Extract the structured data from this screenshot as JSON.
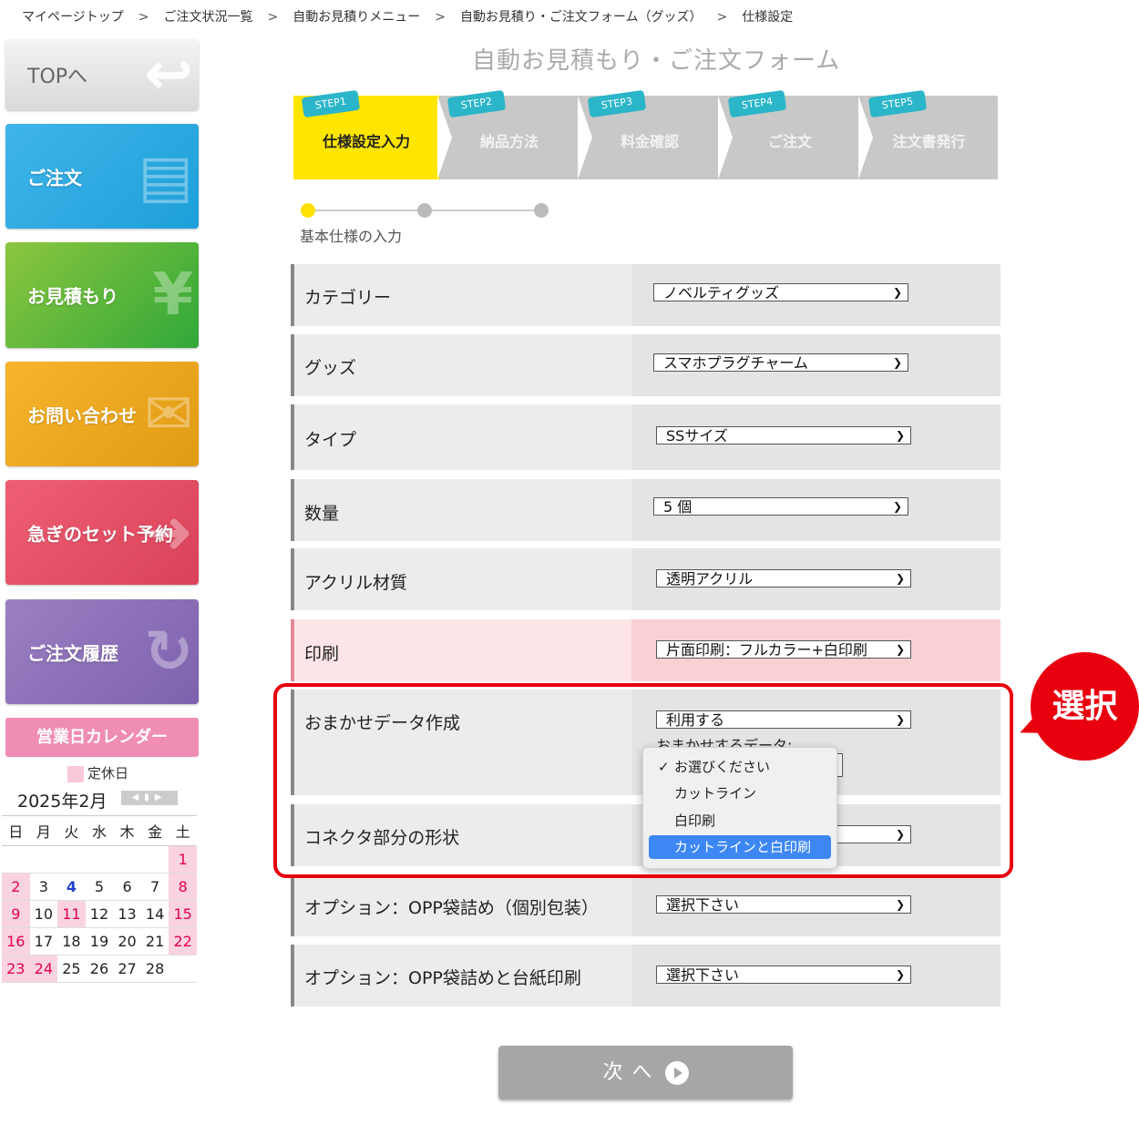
{
  "breadcrumb": [
    "マイページトップ",
    "ご注文状況一覧",
    "自動お見積りメニュー",
    "自動お見積り・ご注文フォーム（グッズ）",
    "仕様設定"
  ],
  "breadcrumb_sep": ">",
  "sidebar": {
    "top": "TOPへ",
    "order": "ご注文",
    "quote": "お見積もり",
    "contact": "お問い合わせ",
    "rush": "急ぎのセット予約",
    "history": "ご注文履歴",
    "yen_glyph": "¥"
  },
  "calendar": {
    "button": "営業日カレンダー",
    "legend": "定休日",
    "month": "2025年2月",
    "weekdays": [
      "日",
      "月",
      "火",
      "水",
      "木",
      "金",
      "土"
    ],
    "weeks": [
      [
        "",
        "",
        "",
        "",
        "",
        "",
        "1"
      ],
      [
        "2",
        "3",
        "4",
        "5",
        "6",
        "7",
        "8"
      ],
      [
        "9",
        "10",
        "11",
        "12",
        "13",
        "14",
        "15"
      ],
      [
        "16",
        "17",
        "18",
        "19",
        "20",
        "21",
        "22"
      ],
      [
        "23",
        "24",
        "25",
        "26",
        "27",
        "28",
        ""
      ]
    ]
  },
  "form_title": "自動お見積もり・ご注文フォーム",
  "steps": [
    {
      "badge": "STEP1",
      "label": "仕様設定入力"
    },
    {
      "badge": "STEP2",
      "label": "納品方法"
    },
    {
      "badge": "STEP3",
      "label": "料金確認"
    },
    {
      "badge": "STEP4",
      "label": "ご注文"
    },
    {
      "badge": "STEP5",
      "label": "注文書発行"
    }
  ],
  "progress_label": "基本仕様の入力",
  "rows": {
    "category": {
      "label": "カテゴリー",
      "value": "ノベルティグッズ"
    },
    "goods": {
      "label": "グッズ",
      "value": "スマホプラグチャーム"
    },
    "type": {
      "label": "タイプ",
      "value": "SSサイズ"
    },
    "quantity": {
      "label": "数量",
      "value": "5 個"
    },
    "acrylic": {
      "label": "アクリル材質",
      "value": "透明アクリル"
    },
    "print": {
      "label": "印刷",
      "value": "片面印刷：フルカラー+白印刷"
    },
    "omakase": {
      "label": "おまかせデータ作成",
      "value": "利用する",
      "sub_label": "おまかせするデータ:"
    },
    "connector": {
      "label": "コネクタ部分の形状",
      "value": ""
    },
    "opp": {
      "label": "オプション：OPP袋詰め（個別包装）",
      "value": "選択下さい"
    },
    "opp_print": {
      "label": "オプション：OPP袋詰めと台紙印刷",
      "value": "選択下さい"
    }
  },
  "dropdown": {
    "options": [
      "お選びください",
      "カットライン",
      "白印刷",
      "カットラインと白印刷"
    ],
    "checked": "お選びください",
    "highlighted": "カットラインと白印刷",
    "checkmark": "✓"
  },
  "annotation": "選択",
  "next_button": "次へ",
  "colors": {
    "accent_red": "#e8000e",
    "step_active": "#ffe600",
    "highlight_blue": "#3d87f5"
  }
}
